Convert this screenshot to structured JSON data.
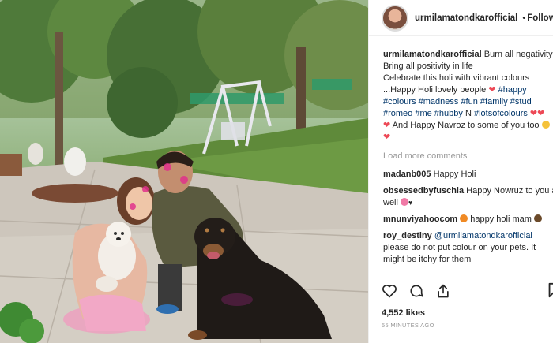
{
  "post": {
    "username": "urmilamatondkarofficial",
    "separator": "•",
    "follow_label": "Follow"
  },
  "caption": {
    "username": "urmilamatondkarofficial",
    "line1": "Burn all negativity",
    "line2": "Bring all positivity in life",
    "line3": "Celebrate this holi with vibrant colours",
    "line4_text": "...Happy Holi lovely people",
    "line4_tag": "#happy",
    "line5": "#colours #madness #fun #family #stud",
    "line6_tags": "#romeo #me #hubby",
    "line6_text": "N",
    "line6_tag2": "#lotsofcolours",
    "line7": "And Happy Navroz to some of you too"
  },
  "load_more": "Load more comments",
  "comments": [
    {
      "username": "madanb005",
      "text": "Happy Holi"
    },
    {
      "username": "obsessedbyfuschia",
      "text": "Happy Nowruz to you as well"
    },
    {
      "username": "mnunviyahoocom",
      "text": "happy holi mam"
    },
    {
      "username": "roy_destiny",
      "mention": "@urmilamatondkarofficial",
      "text": "please do not put colour on your pets. It might be itchy for them"
    }
  ],
  "likes": "4,552 likes",
  "timestamp": "55 MINUTES AGO",
  "icons": [
    "heart-icon",
    "comment-icon",
    "share-icon",
    "bookmark-icon"
  ],
  "colors": {
    "link": "#003569",
    "heart": "#ed4956",
    "muted": "#999999",
    "verified": "#3897f0"
  }
}
